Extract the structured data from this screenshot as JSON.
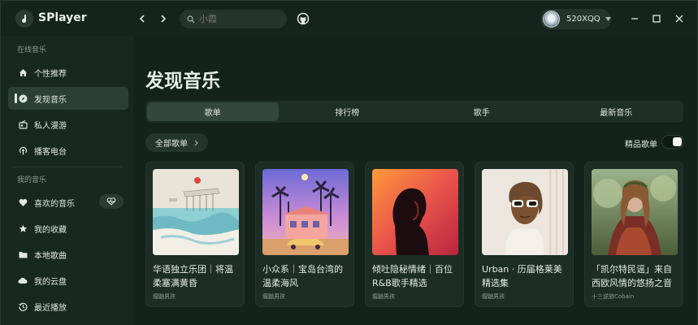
{
  "app": {
    "name": "SPlayer"
  },
  "search": {
    "placeholder": "小霞"
  },
  "user": {
    "name": "520XQQ"
  },
  "sidebar": {
    "section_online": "在线音乐",
    "online_items": [
      {
        "label": "个性推荐",
        "icon": "home-icon"
      },
      {
        "label": "发现音乐",
        "icon": "compass-icon"
      },
      {
        "label": "私人漫游",
        "icon": "radio-icon"
      },
      {
        "label": "播客电台",
        "icon": "podcast-icon"
      }
    ],
    "section_mine": "我的音乐",
    "mine_items": [
      {
        "label": "喜欢的音乐",
        "icon": "heart-icon"
      },
      {
        "label": "我的收藏",
        "icon": "star-icon"
      },
      {
        "label": "本地歌曲",
        "icon": "folder-icon"
      },
      {
        "label": "我的云盘",
        "icon": "cloud-icon"
      },
      {
        "label": "最近播放",
        "icon": "history-icon"
      }
    ]
  },
  "main": {
    "title": "发现音乐",
    "tabs": [
      "歌单",
      "排行榜",
      "歌手",
      "最新音乐"
    ],
    "filter_chip": "全部歌单",
    "toggle_label": "精品歌单",
    "playlists": [
      {
        "title": "华语独立乐团｜将温柔塞满黄昏",
        "creator": "瘤鼬男孩"
      },
      {
        "title": "小众系｜宝岛台湾的温柔海风",
        "creator": "瘤鼬男孩"
      },
      {
        "title": "倾吐隐秘情绪｜百位R&B歌手精选",
        "creator": "瘤鼬男孩"
      },
      {
        "title": "Urban · 历届格莱美精选集",
        "creator": "瘤鼬男孩"
      },
      {
        "title": "「凯尔特民谣」来自西欧风情的悠扬之音",
        "creator": "十三逆旅Cobain"
      }
    ]
  },
  "colors": {
    "background": "#13231c",
    "sidebar": "#172820",
    "active": "#2c3f36",
    "text": "#dfe8e2"
  }
}
